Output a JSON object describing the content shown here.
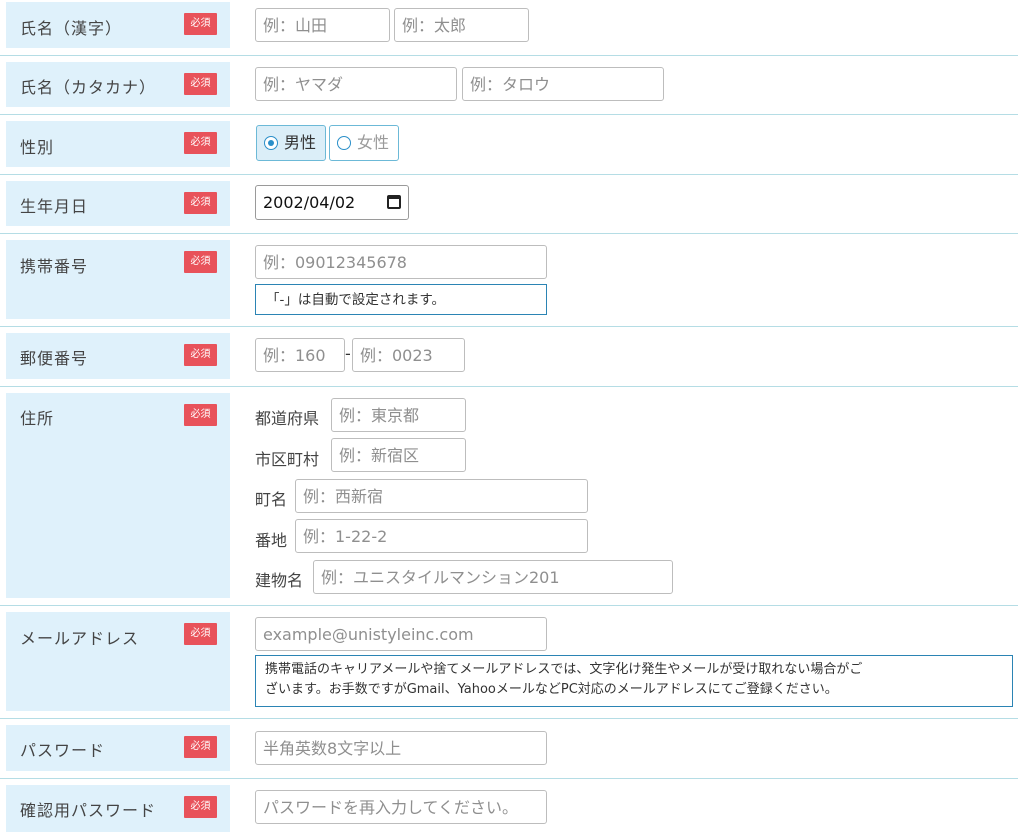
{
  "required_badge": "必須",
  "rows": {
    "name_kanji": {
      "label": "氏名（漢字）",
      "last_placeholder": "例：山田",
      "first_placeholder": "例：太郎"
    },
    "name_kana": {
      "label": "氏名（カタカナ）",
      "last_placeholder": "例：ヤマダ",
      "first_placeholder": "例：タロウ"
    },
    "gender": {
      "label": "性別",
      "options": [
        {
          "label": "男性",
          "checked": true
        },
        {
          "label": "女性",
          "checked": false
        }
      ]
    },
    "birthdate": {
      "label": "生年月日",
      "value": "2002/04/02",
      "icon": "calendar-icon"
    },
    "mobile": {
      "label": "携帯番号",
      "placeholder": "例：09012345678",
      "note": "「-」は自動で設定されます。"
    },
    "postal": {
      "label": "郵便番号",
      "first_placeholder": "例：160",
      "separator": "-",
      "second_placeholder": "例：0023"
    },
    "address": {
      "label": "住所",
      "prefecture_label": "都道府県",
      "prefecture_placeholder": "例：東京都",
      "city_label": "市区町村",
      "city_placeholder": "例：新宿区",
      "town_label": "町名",
      "town_placeholder": "例：西新宿",
      "block_label": "番地",
      "block_placeholder": "例：1-22-2",
      "building_label": "建物名",
      "building_placeholder": "例：ユニスタイルマンション201"
    },
    "email": {
      "label": "メールアドレス",
      "placeholder": "example@unistyleinc.com",
      "note_line1": "携帯電話のキャリアメールや捨てメールアドレスでは、文字化け発生やメールが受け取れない場合がご",
      "note_line2": "ざいます。お手数ですがGmail、YahooメールなどPC対応のメールアドレスにてご登録ください。"
    },
    "password": {
      "label": "パスワード",
      "placeholder": "半角英数8文字以上"
    },
    "password_confirm": {
      "label": "確認用パスワード",
      "placeholder": "パスワードを再入力してください。"
    }
  },
  "colors": {
    "label_bg": "#dff1fb",
    "required_bg": "#e8525a",
    "separator": "#b5dde5",
    "note_border": "#2b84b4",
    "radio_accent": "#2a8fc9"
  }
}
